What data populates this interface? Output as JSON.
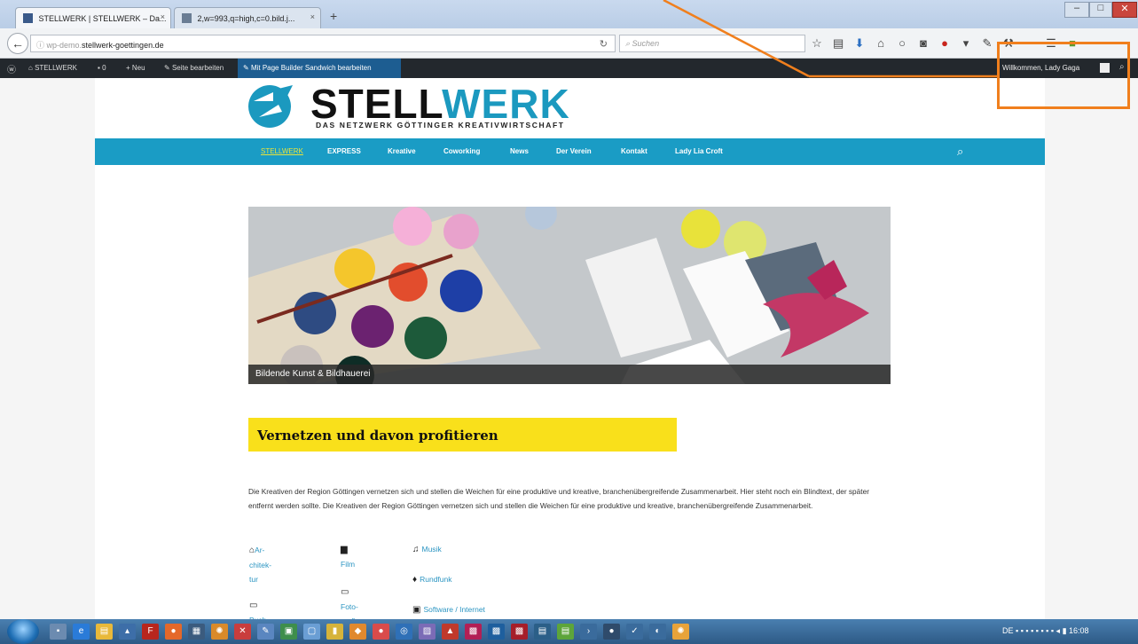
{
  "browser": {
    "tabs": [
      {
        "title": "STELLWERK | STELLWERK – Da..."
      },
      {
        "title": "2,w=993,q=high,c=0.bild.j..."
      }
    ],
    "url_prefix": "wp-demo.",
    "url_domain": "stellwerk-goettingen.de",
    "search_placeholder": "Suchen"
  },
  "adminbar": {
    "site": "STELLWERK",
    "comments": "0",
    "new": "Neu",
    "edit": "Seite bearbeiten",
    "builder": "Mit Page Builder Sandwich bearbeiten",
    "welcome": "Willkommen, Lady Gaga"
  },
  "site": {
    "logo_part1": "STELL",
    "logo_part2": "WERK",
    "tagline": "DAS NETZWERK GÖTTINGER KREATIVWIRTSCHAFT"
  },
  "menu": [
    "STELLWERK",
    "EXPRESS",
    "Kreative",
    "Coworking",
    "News",
    "Der Verein",
    "Kontakt",
    "Lady Lia Croft"
  ],
  "hero": {
    "caption": "Bildende Kunst & Bildhauerei"
  },
  "section": {
    "heading": "Vernetzen und davon profitieren",
    "paragraph": "Die Kreativen der Region Göttingen vernetzen sich und stellen die Weichen für eine produktive und kreative, branchenübergreifende Zusammenarbeit. Hier steht noch ein Blindtext, der später entfernt werden sollte. Die Kreativen der Region Göttingen vernetzen sich und stellen die Weichen für eine produktive und kreative, branchenübergreifende Zusammenarbeit."
  },
  "categories": {
    "architektur": [
      "Ar-",
      "chitek-",
      "tur"
    ],
    "film": "Film",
    "fotografie": [
      "Foto-",
      "grafie"
    ],
    "buch": "Buch",
    "musik": "Musik",
    "rundfunk": "Rundfunk",
    "software": "Software / Internet"
  },
  "taskbar": {
    "time": "16:08",
    "lang": "DE"
  },
  "colors": {
    "accent": "#1a9cc5",
    "yellow": "#f9e01b",
    "annotation": "#f07f1d",
    "adminbar": "#23282d"
  }
}
